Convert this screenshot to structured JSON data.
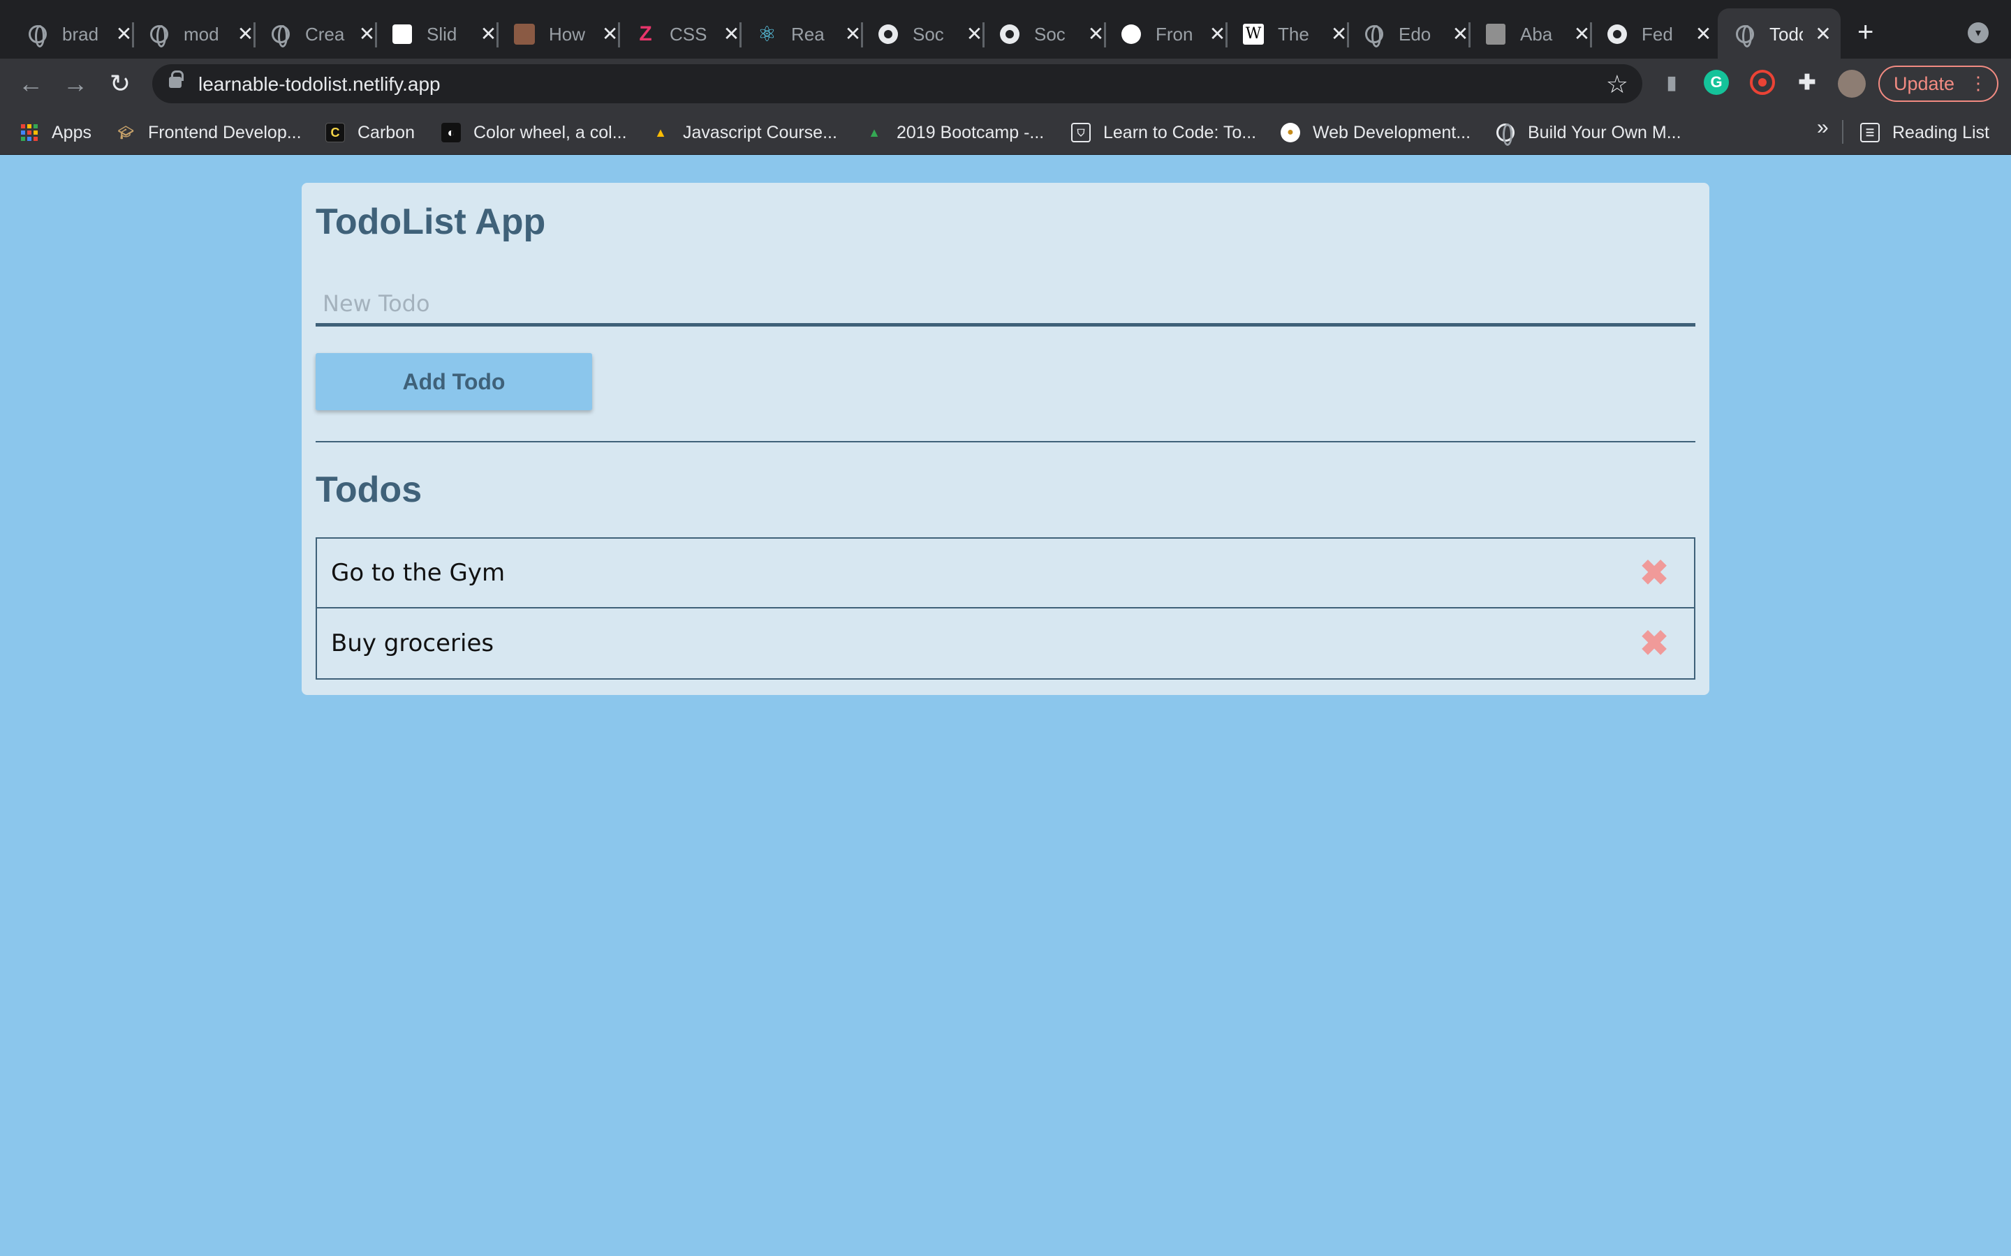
{
  "browser": {
    "tabs": [
      {
        "title": "brad",
        "icon": "globe-icon"
      },
      {
        "title": "mod",
        "icon": "globe-icon"
      },
      {
        "title": "Crea",
        "icon": "globe-icon"
      },
      {
        "title": "Slid",
        "icon": "codepen-icon"
      },
      {
        "title": "How",
        "icon": "avatar-icon"
      },
      {
        "title": "CSS",
        "icon": "z-logo-icon"
      },
      {
        "title": "Rea",
        "icon": "react-icon"
      },
      {
        "title": "Soc",
        "icon": "github-icon"
      },
      {
        "title": "Soc",
        "icon": "github-icon"
      },
      {
        "title": "Fron",
        "icon": "compass-icon"
      },
      {
        "title": "The",
        "icon": "wikipedia-icon"
      },
      {
        "title": "Edo",
        "icon": "globe-icon"
      },
      {
        "title": "Aba",
        "icon": "photo-icon"
      },
      {
        "title": "Fed",
        "icon": "github-icon"
      },
      {
        "title": "Todo",
        "icon": "globe-icon",
        "active": true
      }
    ],
    "url": "learnable-todolist.netlify.app",
    "update_label": "Update",
    "bookmarks": [
      {
        "label": "Apps",
        "icon": "apps-grid-icon"
      },
      {
        "label": "Frontend Develop...",
        "icon": "graduation-cap-icon"
      },
      {
        "label": "Carbon",
        "icon": "carbon-icon"
      },
      {
        "label": "Color wheel, a col...",
        "icon": "color-wheel-icon"
      },
      {
        "label": "Javascript Course...",
        "icon": "google-drive-icon"
      },
      {
        "label": "2019 Bootcamp -...",
        "icon": "google-drive-icon"
      },
      {
        "label": "Learn to Code: To...",
        "icon": "shield-icon"
      },
      {
        "label": "Web Development...",
        "icon": "bear-icon"
      },
      {
        "label": "Build Your Own M...",
        "icon": "globe-icon"
      }
    ],
    "reading_list_label": "Reading List",
    "colors": {
      "tab_bar": "#202124",
      "toolbar": "#35363a",
      "update_accent": "#f28b82"
    }
  },
  "app": {
    "title": "TodoList App",
    "input": {
      "placeholder": "New Todo",
      "value": ""
    },
    "add_button_label": "Add Todo",
    "list_title": "Todos",
    "todos": [
      {
        "text": "Go to the Gym",
        "delete_icon": "close-x-icon"
      },
      {
        "text": "Buy groceries",
        "delete_icon": "close-x-icon"
      }
    ],
    "colors": {
      "page_background": "#8bc6ec",
      "card": "#d7e7f1",
      "accent": "#3f6179",
      "delete": "#f09a99"
    }
  }
}
